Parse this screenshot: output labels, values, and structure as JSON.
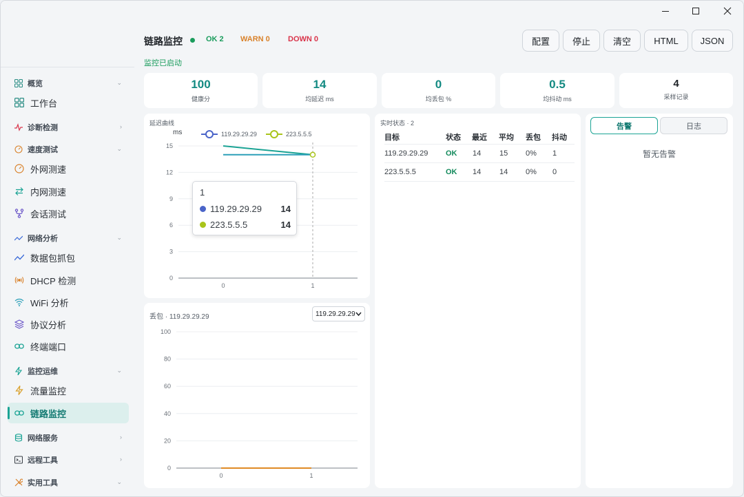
{
  "window": {
    "minimize": "minimize",
    "maximize": "maximize",
    "close": "close"
  },
  "sidebar": {
    "groups": [
      {
        "label": "概览",
        "icon": "grid-icon",
        "chevron": "⌄"
      },
      {
        "label": "诊断检测",
        "icon": "pulse-icon",
        "chevron": "›"
      },
      {
        "label": "速度测试",
        "icon": "speedometer-icon",
        "chevron": "⌄"
      },
      {
        "label": "网络分析",
        "icon": "trend-icon",
        "chevron": "⌄"
      },
      {
        "label": "监控运维",
        "icon": "bolt-icon",
        "chevron": "⌄"
      },
      {
        "label": "网络服务",
        "icon": "database-icon",
        "chevron": "›"
      },
      {
        "label": "远程工具",
        "icon": "terminal-icon",
        "chevron": "›"
      },
      {
        "label": "实用工具",
        "icon": "tools-icon",
        "chevron": "⌄"
      }
    ],
    "items": [
      {
        "label": "工作台",
        "icon": "grid-icon"
      },
      {
        "label": "外网测速",
        "icon": "speedometer-icon"
      },
      {
        "label": "内网测速",
        "icon": "swap-icon"
      },
      {
        "label": "会话测试",
        "icon": "fork-icon"
      },
      {
        "label": "数据包抓包",
        "icon": "trend-icon"
      },
      {
        "label": "DHCP 检测",
        "icon": "broadcast-icon"
      },
      {
        "label": "WiFi 分析",
        "icon": "wifi-icon"
      },
      {
        "label": "协议分析",
        "icon": "layers-icon"
      },
      {
        "label": "终端端口",
        "icon": "link-icon"
      },
      {
        "label": "流量监控",
        "icon": "bolt-icon"
      },
      {
        "label": "链路监控",
        "icon": "link-icon"
      }
    ],
    "active_item": "链路监控"
  },
  "header": {
    "title": "链路监控",
    "ok": "OK 2",
    "warn": "WARN 0",
    "down": "DOWN 0",
    "status": "监控已启动",
    "buttons": {
      "config": "配置",
      "stop": "停止",
      "clear": "清空",
      "html": "HTML",
      "json": "JSON"
    }
  },
  "stats": [
    {
      "value": "100",
      "label": "健康分"
    },
    {
      "value": "14",
      "label": "均延迟 ms"
    },
    {
      "value": "0",
      "label": "均丢包 %"
    },
    {
      "value": "0.5",
      "label": "均抖动 ms"
    },
    {
      "value": "4",
      "label": "采样记录"
    }
  ],
  "latency": {
    "title": "延迟曲线",
    "tooltip": {
      "x": "1",
      "rows": [
        {
          "name": "119.29.29.29",
          "value": "14"
        },
        {
          "name": "223.5.5.5",
          "value": "14"
        }
      ]
    }
  },
  "loss": {
    "title": "丢包 · 119.29.29.29",
    "select": "119.29.29.29"
  },
  "realtime": {
    "title": "实时状态 · 2",
    "headers": [
      "目标",
      "状态",
      "最近",
      "平均",
      "丢包",
      "抖动"
    ],
    "rows": [
      [
        "119.29.29.29",
        "OK",
        "14",
        "15",
        "0%",
        "1"
      ],
      [
        "223.5.5.5",
        "OK",
        "14",
        "14",
        "0%",
        "0"
      ]
    ]
  },
  "alerts": {
    "tabs": [
      "告警",
      "日志"
    ],
    "empty": "暂无告警"
  },
  "colors": {
    "accent": "#138a82",
    "ok": "#1a9c5c",
    "warn": "#d9822b",
    "down": "#d9344a",
    "series1": "#4a64c8",
    "series2": "#a9c41a",
    "line1": "#1aa394",
    "line2": "#2b9fb8",
    "loss": "#e08a24"
  },
  "chart_data": [
    {
      "type": "line",
      "x": [
        0,
        1
      ],
      "ylabel": "ms",
      "ylim": [
        0,
        15
      ],
      "yticks": [
        0,
        3,
        6,
        9,
        12,
        15
      ],
      "legend": "top",
      "grid": true,
      "series": [
        {
          "name": "119.29.29.29",
          "values": [
            15,
            14
          ]
        },
        {
          "name": "223.5.5.5",
          "values": [
            14,
            14
          ]
        }
      ]
    },
    {
      "type": "line",
      "x": [
        0,
        1
      ],
      "ylim": [
        0,
        100
      ],
      "yticks": [
        0,
        20,
        40,
        60,
        80,
        100
      ],
      "grid": true,
      "series": [
        {
          "name": "119.29.29.29",
          "values": [
            0,
            0
          ]
        }
      ]
    }
  ]
}
